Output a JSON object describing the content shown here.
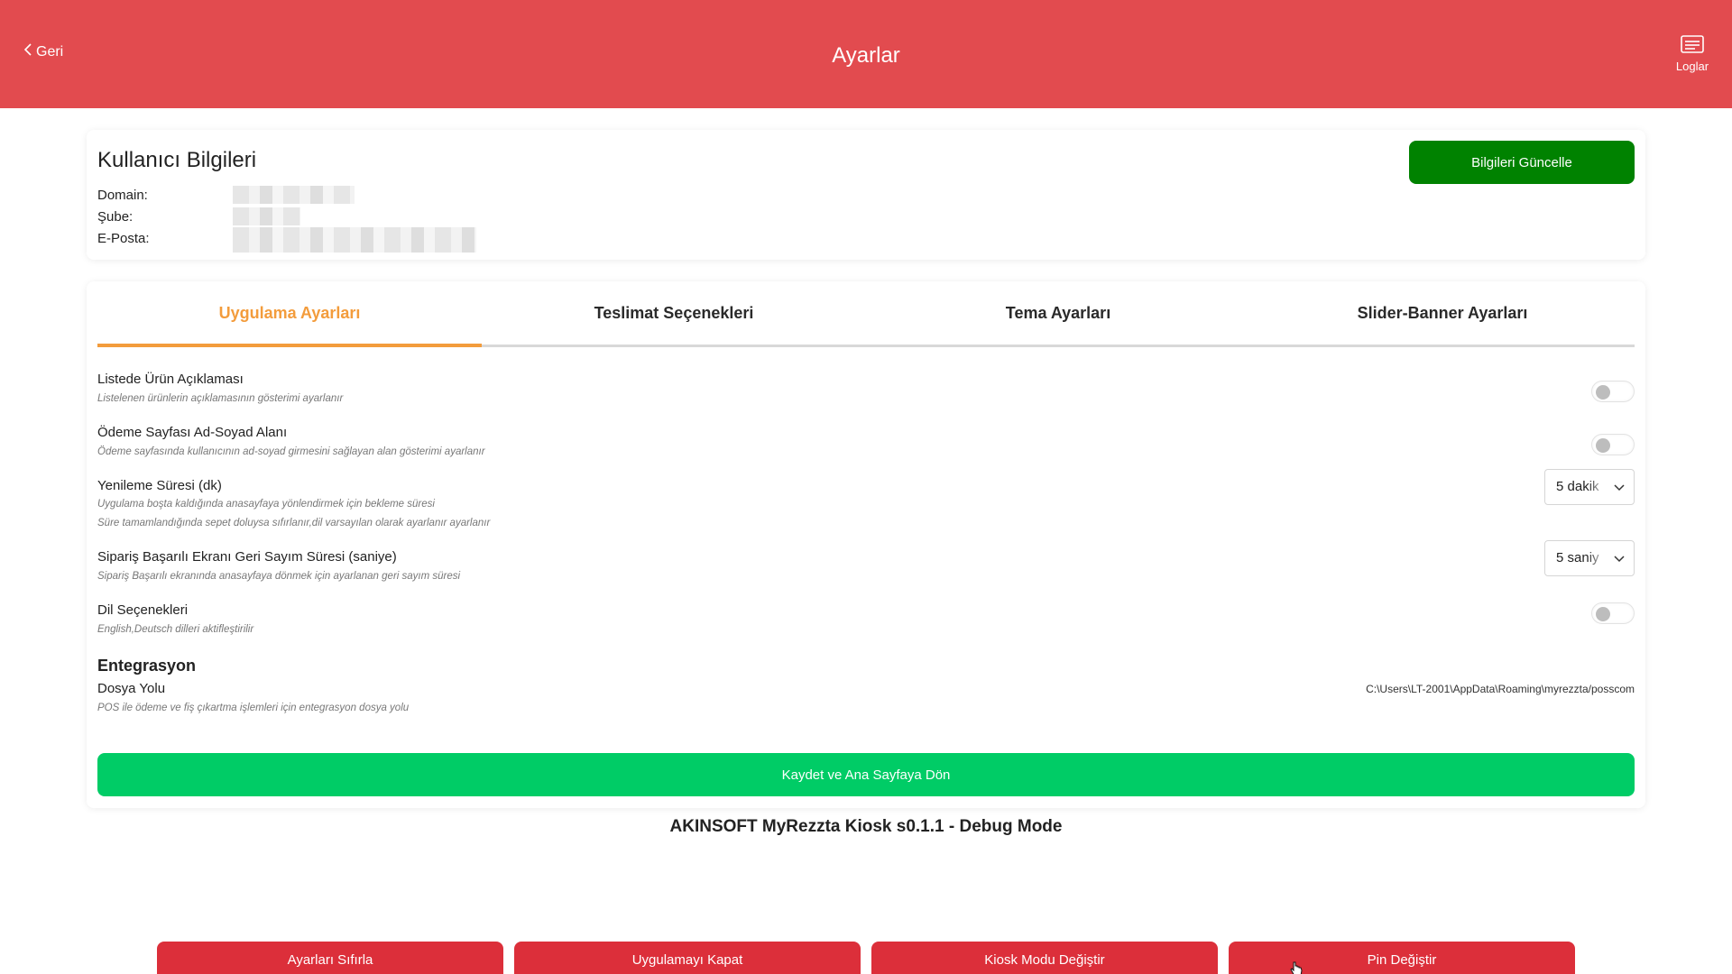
{
  "header": {
    "back_label": "Geri",
    "title": "Ayarlar",
    "logs_label": "Loglar",
    "background_color": "#e24b4f",
    "icons": {
      "back": "chevron-left-icon",
      "logs": "log-list-icon"
    }
  },
  "user_info": {
    "title": "Kullanıcı Bilgileri",
    "fields": [
      {
        "label": "Domain:"
      },
      {
        "label": "Şube:"
      },
      {
        "label": "E-Posta:"
      }
    ],
    "update_button": "Bilgileri Güncelle",
    "update_button_color": "#008200"
  },
  "tabs": [
    {
      "label": "Uygulama Ayarları",
      "active": true
    },
    {
      "label": "Teslimat Seçenekleri",
      "active": false
    },
    {
      "label": "Tema Ayarları",
      "active": false
    },
    {
      "label": "Slider-Banner Ayarları",
      "active": false
    }
  ],
  "accent_color": "#f39c3c",
  "settings": [
    {
      "title": "Listede Ürün Açıklaması",
      "desc": "Listelenen ürünlerin açıklamasının gösterimi ayarlanır",
      "control": "toggle",
      "on": false
    },
    {
      "title": "Ödeme Sayfası Ad-Soyad Alanı",
      "desc": "Ödeme sayfasında kullanıcının ad-soyad girmesini sağlayan alan gösterimi ayarlanır",
      "control": "toggle",
      "on": false
    },
    {
      "title": "Yenileme Süresi (dk)",
      "desc": "Uygulama boşta kaldığında anasayfaya yönlendirmek için bekleme süresi",
      "desc2": "Süre tamamlandığında sepet doluysa sıfırlanır,dil varsayılan olarak ayarlanır ayarlanır",
      "control": "select",
      "value": "5 dakik"
    },
    {
      "title": "Sipariş Başarılı Ekranı Geri Sayım Süresi (saniye)",
      "desc": "Sipariş Başarılı ekranında anasayfaya dönmek için ayarlanan geri sayım süresi",
      "control": "select",
      "value": "5 saniy"
    },
    {
      "title": "Dil Seçenekleri",
      "desc": "English,Deutsch dilleri aktifleştirilir",
      "control": "toggle",
      "on": false
    }
  ],
  "integration": {
    "section_title": "Entegrasyon",
    "title": "Dosya Yolu",
    "desc": "POS ile ödeme ve fiş çıkartma işlemleri için entegrasyon dosya yolu",
    "path": "C:\\Users\\LT-2001\\AppData\\Roaming\\myrezzta/posscom"
  },
  "save_button": "Kaydet ve Ana Sayfaya Dön",
  "save_button_color": "#00cc66",
  "version_text": "AKINSOFT MyRezzta Kiosk s0.1.1 - Debug Mode",
  "bottom_buttons": [
    "Ayarları Sıfırla",
    "Uygulamayı Kapat",
    "Kiosk Modu Değiştir",
    "Pin Değiştir"
  ],
  "bottom_button_color": "#dc2f3a"
}
